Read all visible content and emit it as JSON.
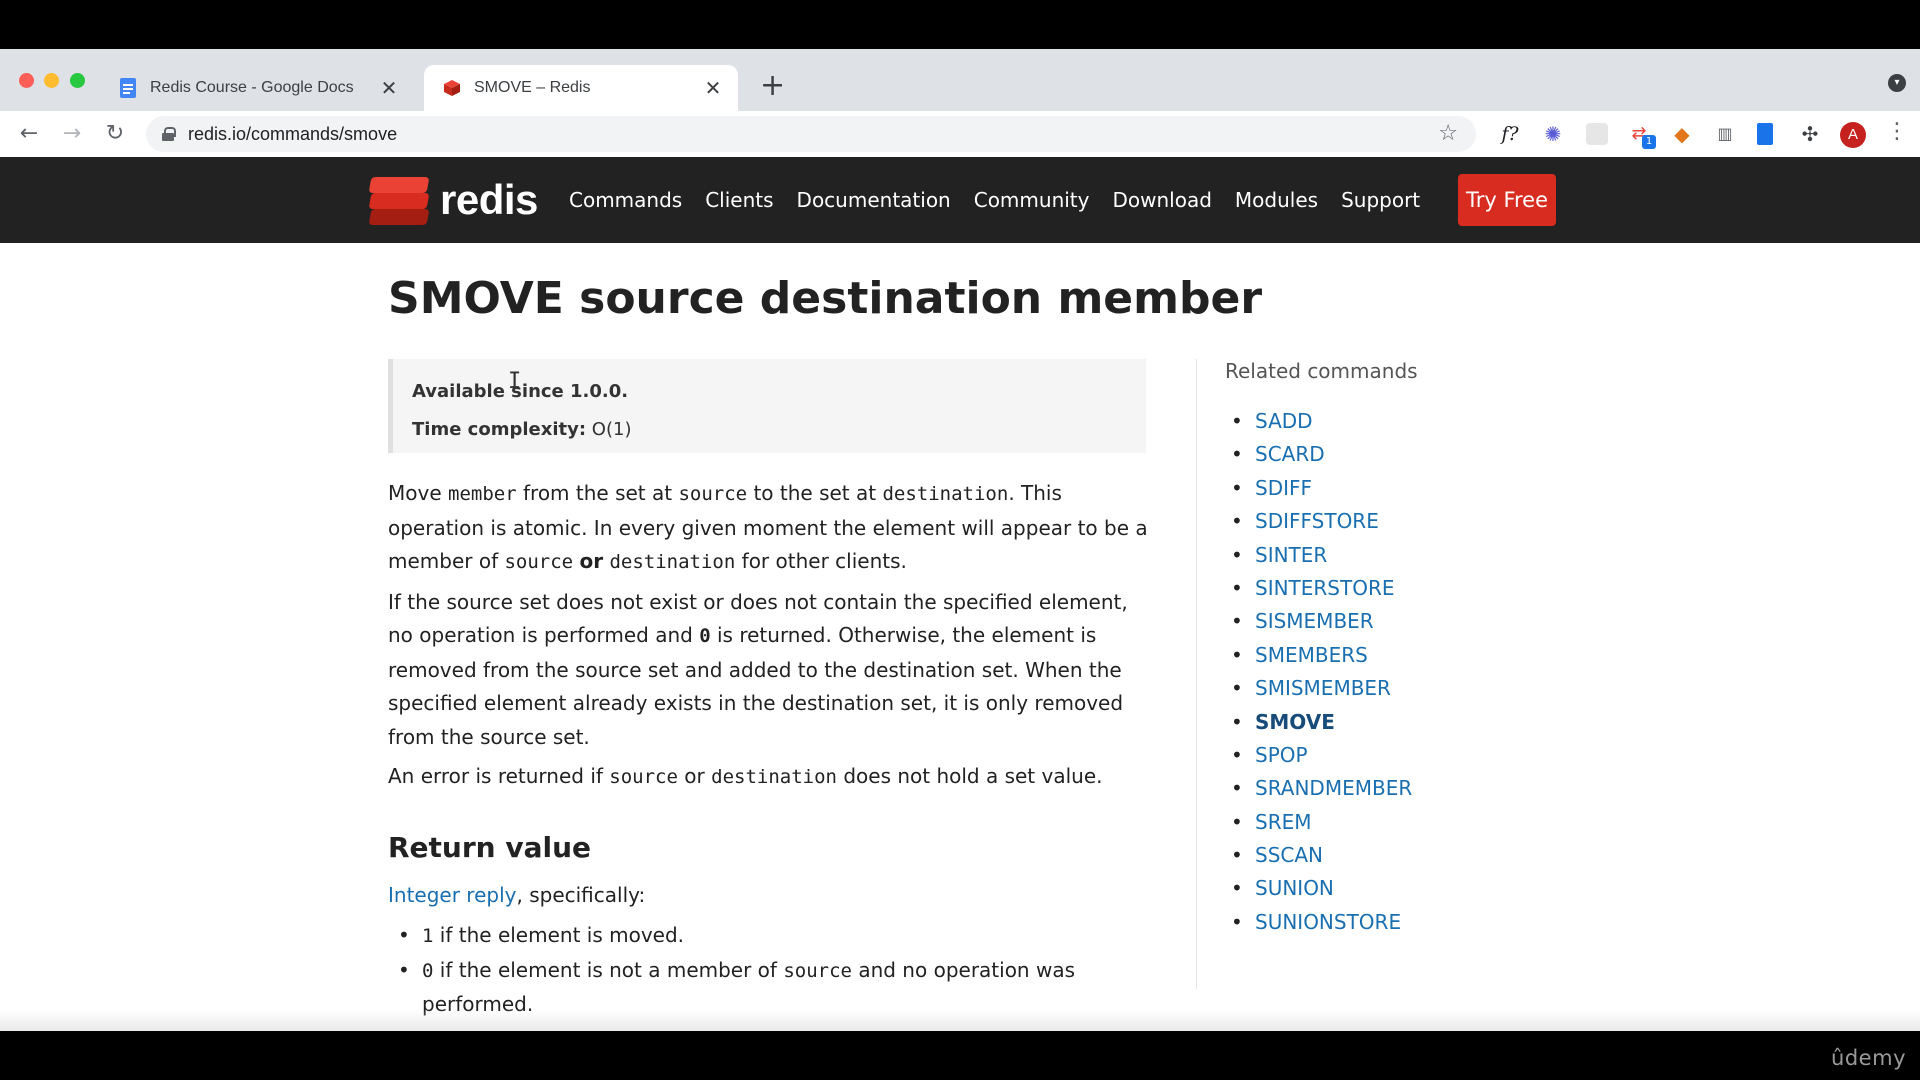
{
  "browser": {
    "tabs": [
      {
        "title": "Redis Course - Google Docs",
        "close": "✕"
      },
      {
        "title": "SMOVE – Redis",
        "close": "✕"
      }
    ],
    "new_tab": "+",
    "url": "redis.io/commands/smove",
    "avatar_initial": "A",
    "extension_badge": "1",
    "extension_fx": "f?"
  },
  "site": {
    "logo_text": "redis",
    "nav": [
      "Commands",
      "Clients",
      "Documentation",
      "Community",
      "Download",
      "Modules",
      "Support"
    ],
    "cta": "Try Free"
  },
  "page": {
    "title": "SMOVE source destination member",
    "available_label": "Available since 1.0.0.",
    "complexity_label": "Time complexity:",
    "complexity_value": "O(1)",
    "p1": {
      "t1": "Move ",
      "c1": "member",
      "t2": " from the set at ",
      "c2": "source",
      "t3": " to the set at ",
      "c3": "destination",
      "t4": ". This operation is atomic. In every given moment the element will appear to be a member of ",
      "c4": "source",
      "b1": "or",
      "c5": "destination",
      "t5": " for other clients."
    },
    "p2": {
      "t1": "If the source set does not exist or does not contain the specified element, no operation is performed and ",
      "c1": "0",
      "t2": " is returned. Otherwise, the element is removed from the source set and added to the destination set. When the specified element already exists in the destination set, it is only removed from the source set."
    },
    "p3": {
      "t1": "An error is returned if ",
      "c1": "source",
      "t2": " or ",
      "c2": "destination",
      "t3": " does not hold a set value."
    },
    "return_title": "Return value",
    "return_link": "Integer reply",
    "return_suffix": ", specifically:",
    "return_items": [
      {
        "code": "1",
        "text": " if the element is moved."
      },
      {
        "code": "0",
        "text": " if the element is not a member of ",
        "code2": "source",
        "text2": " and no operation was performed."
      }
    ]
  },
  "sidebar": {
    "title": "Related commands",
    "commands": [
      "SADD",
      "SCARD",
      "SDIFF",
      "SDIFFSTORE",
      "SINTER",
      "SINTERSTORE",
      "SISMEMBER",
      "SMEMBERS",
      "SMISMEMBER",
      "SMOVE",
      "SPOP",
      "SRANDMEMBER",
      "SREM",
      "SSCAN",
      "SUNION",
      "SUNIONSTORE"
    ],
    "current": "SMOVE"
  },
  "watermark": "ûdemy",
  "colors": {
    "brand_red": "#d82c20",
    "header_bg": "#222222",
    "link": "#1a6fb0"
  }
}
